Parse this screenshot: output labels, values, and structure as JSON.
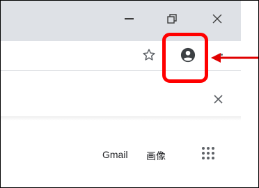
{
  "window_controls": {
    "minimize_icon": "minimize-icon",
    "restore_icon": "restore-icon",
    "close_icon": "close-icon"
  },
  "toolbar": {
    "bookmark_icon": "star-icon",
    "profile_icon": "account-circle-icon"
  },
  "annotation": {
    "highlight_color": "#ff0000"
  },
  "google_header": {
    "gmail_label": "Gmail",
    "images_label": "画像",
    "apps_icon": "apps-grid-icon"
  }
}
